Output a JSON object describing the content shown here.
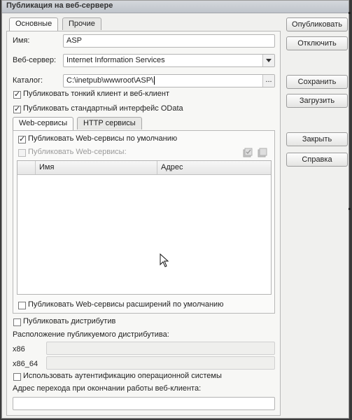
{
  "window": {
    "title": "Публикация на веб-сервере"
  },
  "tabs": [
    {
      "label": "Основные",
      "active": true
    },
    {
      "label": "Прочие",
      "active": false
    }
  ],
  "fields": {
    "name_label": "Имя:",
    "name_value": "ASP",
    "server_label": "Веб-сервер:",
    "server_value": "Internet Information Services",
    "catalog_label": "Каталог:",
    "catalog_value": "C:\\inetpub\\wwwroot\\ASP\\",
    "catalog_button": "..."
  },
  "checks": {
    "thin_client": {
      "label": "Публиковать тонкий клиент и веб-клиент",
      "checked": true
    },
    "odata": {
      "label": "Публиковать стандартный интерфейс OData",
      "checked": true
    }
  },
  "inner_tabs": [
    {
      "label": "Web-сервисы",
      "active": true
    },
    {
      "label": "HTTP сервисы",
      "active": false
    }
  ],
  "web_services": {
    "default_publish": {
      "label": "Публиковать Web-сервисы по умолчанию",
      "checked": true
    },
    "publish": {
      "label": "Публиковать Web-сервисы:",
      "checked": false,
      "disabled": true
    },
    "columns": [
      "Имя",
      "Адрес"
    ],
    "extensions": {
      "label": "Публиковать Web-сервисы расширений по умолчанию",
      "checked": false
    }
  },
  "distrib": {
    "publish": {
      "label": "Публиковать дистрибутив",
      "checked": false
    },
    "location_label": "Расположение публикуемого дистрибутива:",
    "x86_label": "x86",
    "x86_64_label": "x86_64"
  },
  "auth": {
    "label": "Использовать аутентификацию операционной системы",
    "checked": false
  },
  "redirect_label": "Адрес перехода при окончании работы веб-клиента:",
  "buttons": {
    "publish": "Опубликовать",
    "unpublish": "Отключить",
    "save": "Сохранить",
    "load": "Загрузить",
    "close": "Закрыть",
    "help": "Справка"
  },
  "icons": {
    "table_tool_1": "check-all-icon",
    "table_tool_2": "uncheck-all-icon",
    "pointer": "mouse-pointer-icon"
  }
}
